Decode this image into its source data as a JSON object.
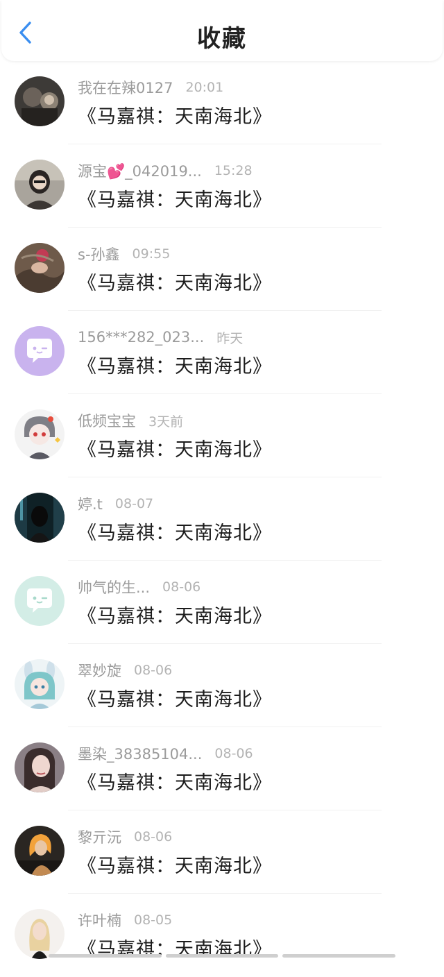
{
  "header": {
    "title": "收藏"
  },
  "colors": {
    "accent": "#3a8ef0",
    "name": "#9b9b9b",
    "time": "#b3b3b3",
    "content": "#1c1c1c"
  },
  "items": [
    {
      "name": "我在在辣0127",
      "time": "20:01",
      "content": "《马嘉祺：天南海北》",
      "avatar": "photo-dark"
    },
    {
      "name": "源宝💕_042019...",
      "time": "15:28",
      "content": "《马嘉祺：天南海北》",
      "avatar": "photo-girl"
    },
    {
      "name": "s-孙鑫",
      "time": "09:55",
      "content": "《马嘉祺：天南海北》",
      "avatar": "photo-brown"
    },
    {
      "name": "156***282_023...",
      "time": "昨天",
      "content": "《马嘉祺：天南海北》",
      "avatar": "default-purple"
    },
    {
      "name": "低频宝宝",
      "time": "3天前",
      "content": "《马嘉祺：天南海北》",
      "avatar": "anime-boy"
    },
    {
      "name": "婷.t",
      "time": "08-07",
      "content": "《马嘉祺：天南海北》",
      "avatar": "photo-night"
    },
    {
      "name": "帅气的生...",
      "time": "08-06",
      "content": "《马嘉祺：天南海北》",
      "avatar": "default-green"
    },
    {
      "name": "翠妙旋",
      "time": "08-06",
      "content": "《马嘉祺：天南海北》",
      "avatar": "anime-girl"
    },
    {
      "name": "墨染_38385104...",
      "time": "08-06",
      "content": "《马嘉祺：天南海北》",
      "avatar": "photo-woman"
    },
    {
      "name": "黎亓沅",
      "time": "08-06",
      "content": "《马嘉祺：天南海北》",
      "avatar": "photo-blonde"
    },
    {
      "name": "许叶楠",
      "time": "08-05",
      "content": "《马嘉祺：天南海北》",
      "avatar": "photo-light"
    }
  ]
}
